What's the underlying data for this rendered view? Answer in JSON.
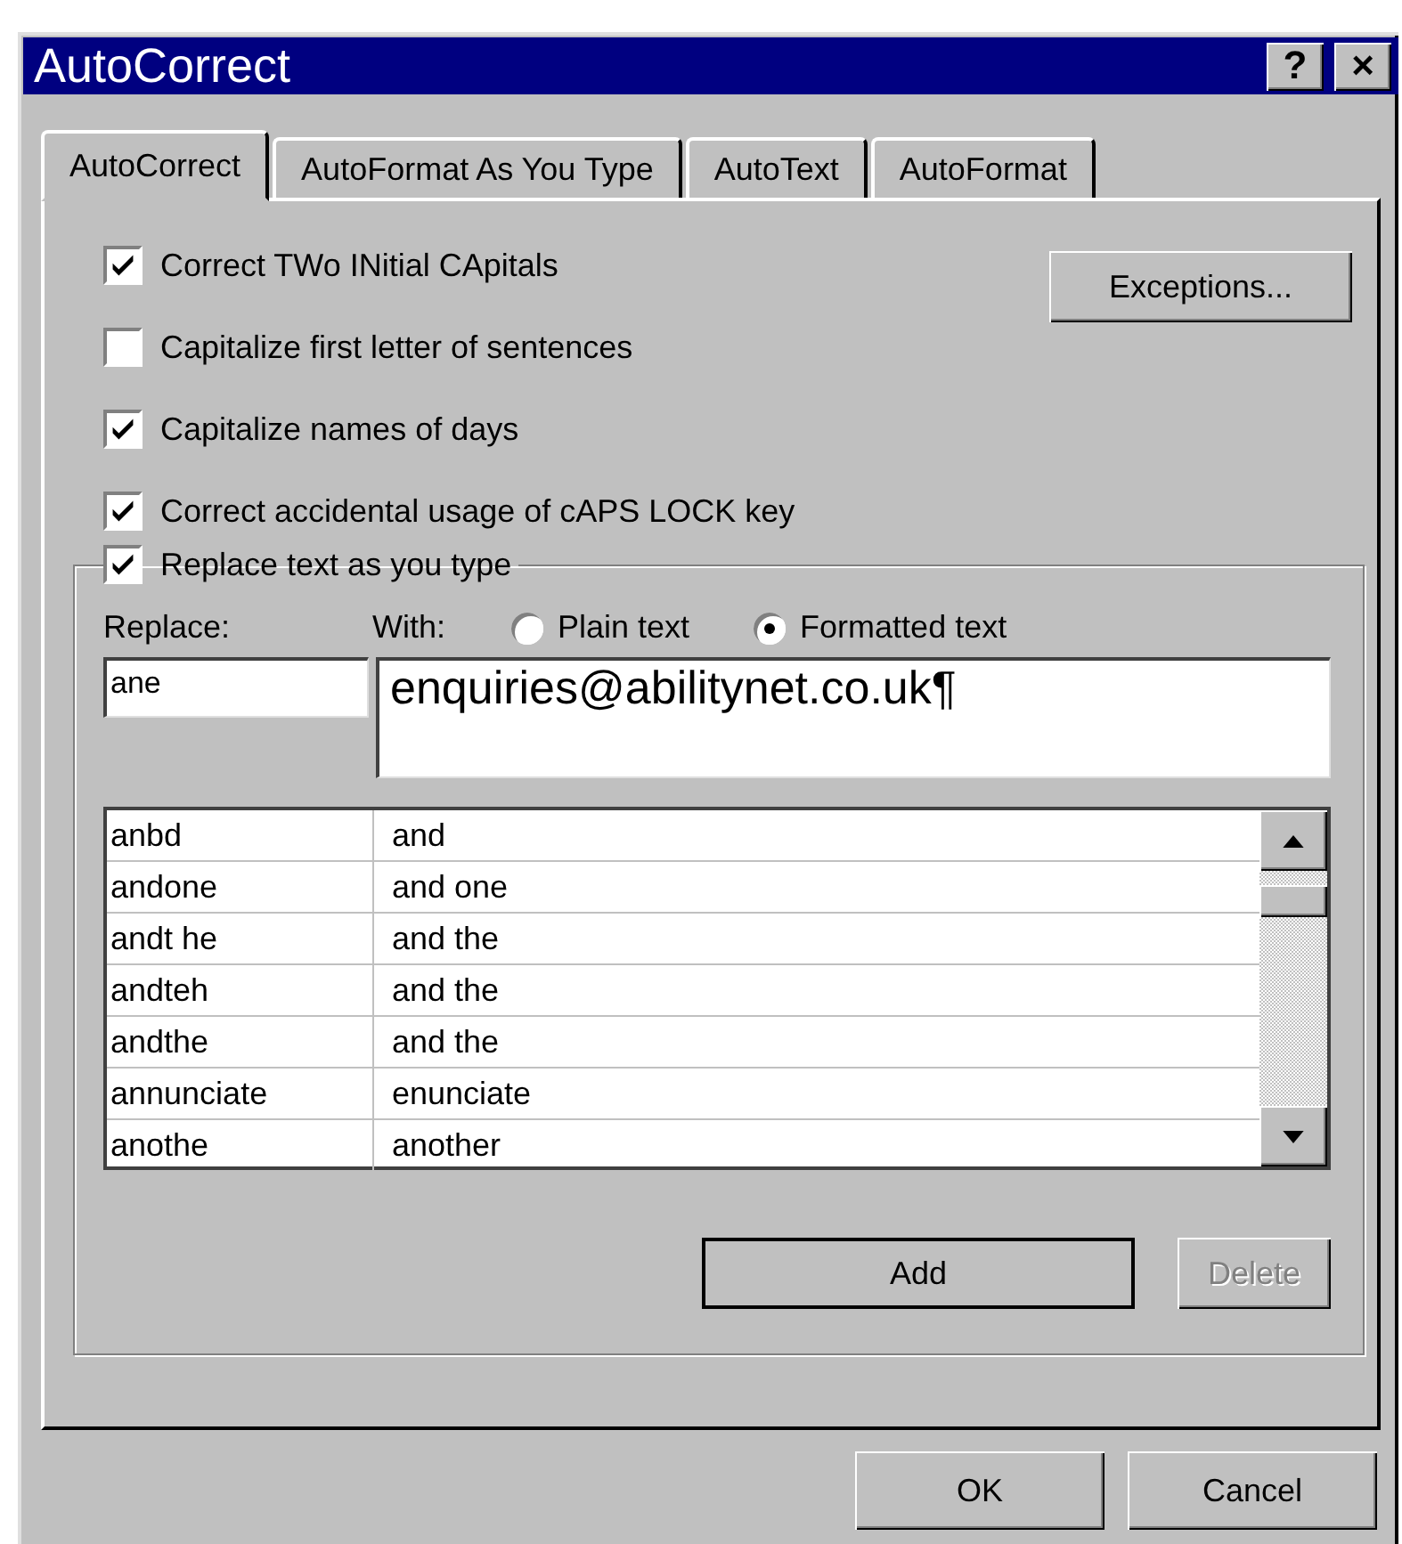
{
  "window": {
    "title": "AutoCorrect",
    "help_button": "?",
    "close_button": "×"
  },
  "tabs": [
    {
      "label": "AutoCorrect",
      "selected": true
    },
    {
      "label": "AutoFormat As You Type",
      "selected": false
    },
    {
      "label": "AutoText",
      "selected": false
    },
    {
      "label": "AutoFormat",
      "selected": false
    }
  ],
  "options": [
    {
      "label": "Correct TWo INitial CApitals",
      "checked": true
    },
    {
      "label": "Capitalize first letter of sentences",
      "checked": false
    },
    {
      "label": "Capitalize names of days",
      "checked": true
    },
    {
      "label": "Correct accidental usage of cAPS LOCK key",
      "checked": true
    }
  ],
  "exceptions_button": "Exceptions...",
  "replace_group": {
    "label": "Replace text as you type",
    "checked": true,
    "replace_label": "Replace:",
    "with_label": "With:",
    "format_options": [
      {
        "label": "Plain text",
        "selected": false
      },
      {
        "label": "Formatted text",
        "selected": true
      }
    ],
    "replace_value": "ane",
    "with_value": "enquiries@abilitynet.co.uk¶",
    "rows": [
      {
        "replace": "anbd",
        "with": "and"
      },
      {
        "replace": "andone",
        "with": "and one"
      },
      {
        "replace": "andt he",
        "with": "and the"
      },
      {
        "replace": "andteh",
        "with": "and the"
      },
      {
        "replace": "andthe",
        "with": "and the"
      },
      {
        "replace": "annunciate",
        "with": "enunciate"
      },
      {
        "replace": "anothe",
        "with": "another"
      }
    ],
    "buttons": [
      {
        "label": "Add",
        "disabled": false,
        "default": true
      },
      {
        "label": "Delete",
        "disabled": true,
        "default": false
      }
    ]
  },
  "footer_buttons": [
    {
      "label": "OK"
    },
    {
      "label": "Cancel"
    }
  ]
}
